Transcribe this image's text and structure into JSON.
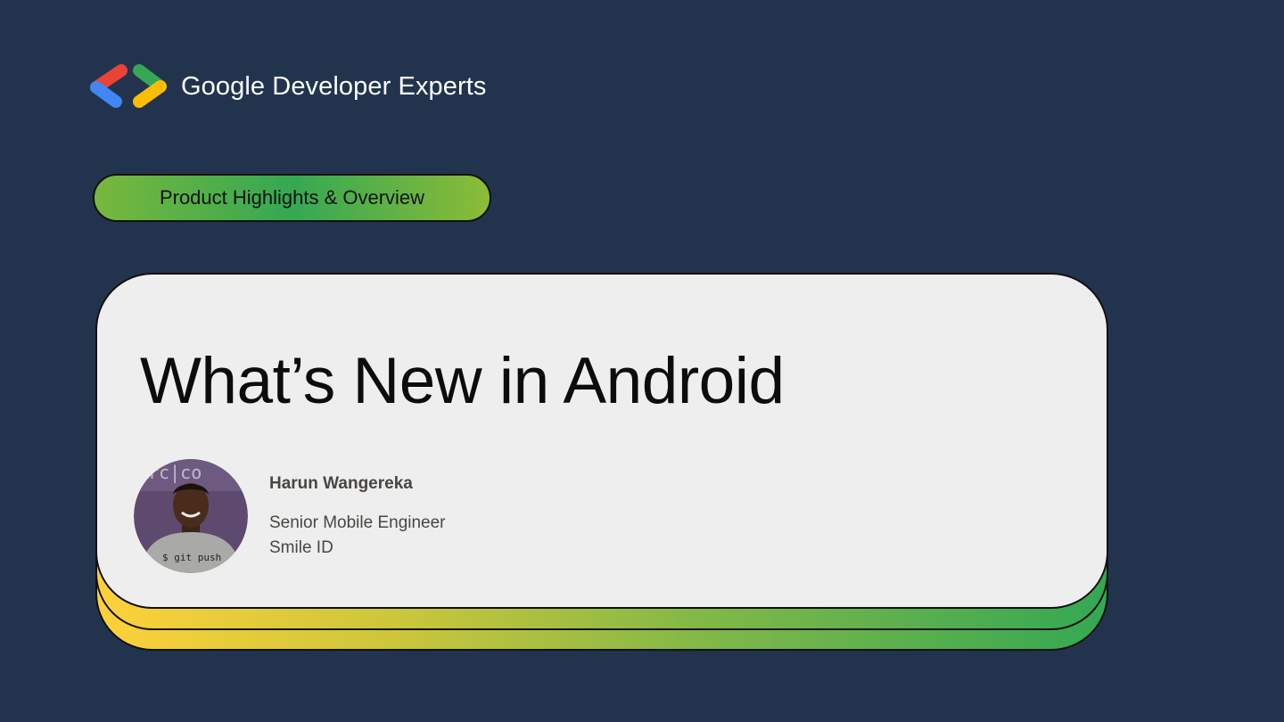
{
  "brand": {
    "name": "Google Developer Experts",
    "logo_icon": "gde-chevrons-logo",
    "logo_colors": {
      "red": "#ea4335",
      "blue": "#4285f4",
      "green": "#34a853",
      "yellow": "#fbbc04"
    }
  },
  "category": {
    "label": "Product Highlights & Overview"
  },
  "card": {
    "title": "What’s New in Android",
    "accent_gradient": [
      "#fdd13a",
      "#34a853"
    ]
  },
  "speaker": {
    "name": "Harun Wangereka",
    "role": "Senior Mobile Engineer",
    "company": "Smile ID",
    "photo_shirt_text": "$ git push"
  },
  "colors": {
    "background": "#22344d",
    "card": "#eeeeee",
    "text_dark": "#0c0c0c",
    "text_muted": "#4a4642"
  }
}
